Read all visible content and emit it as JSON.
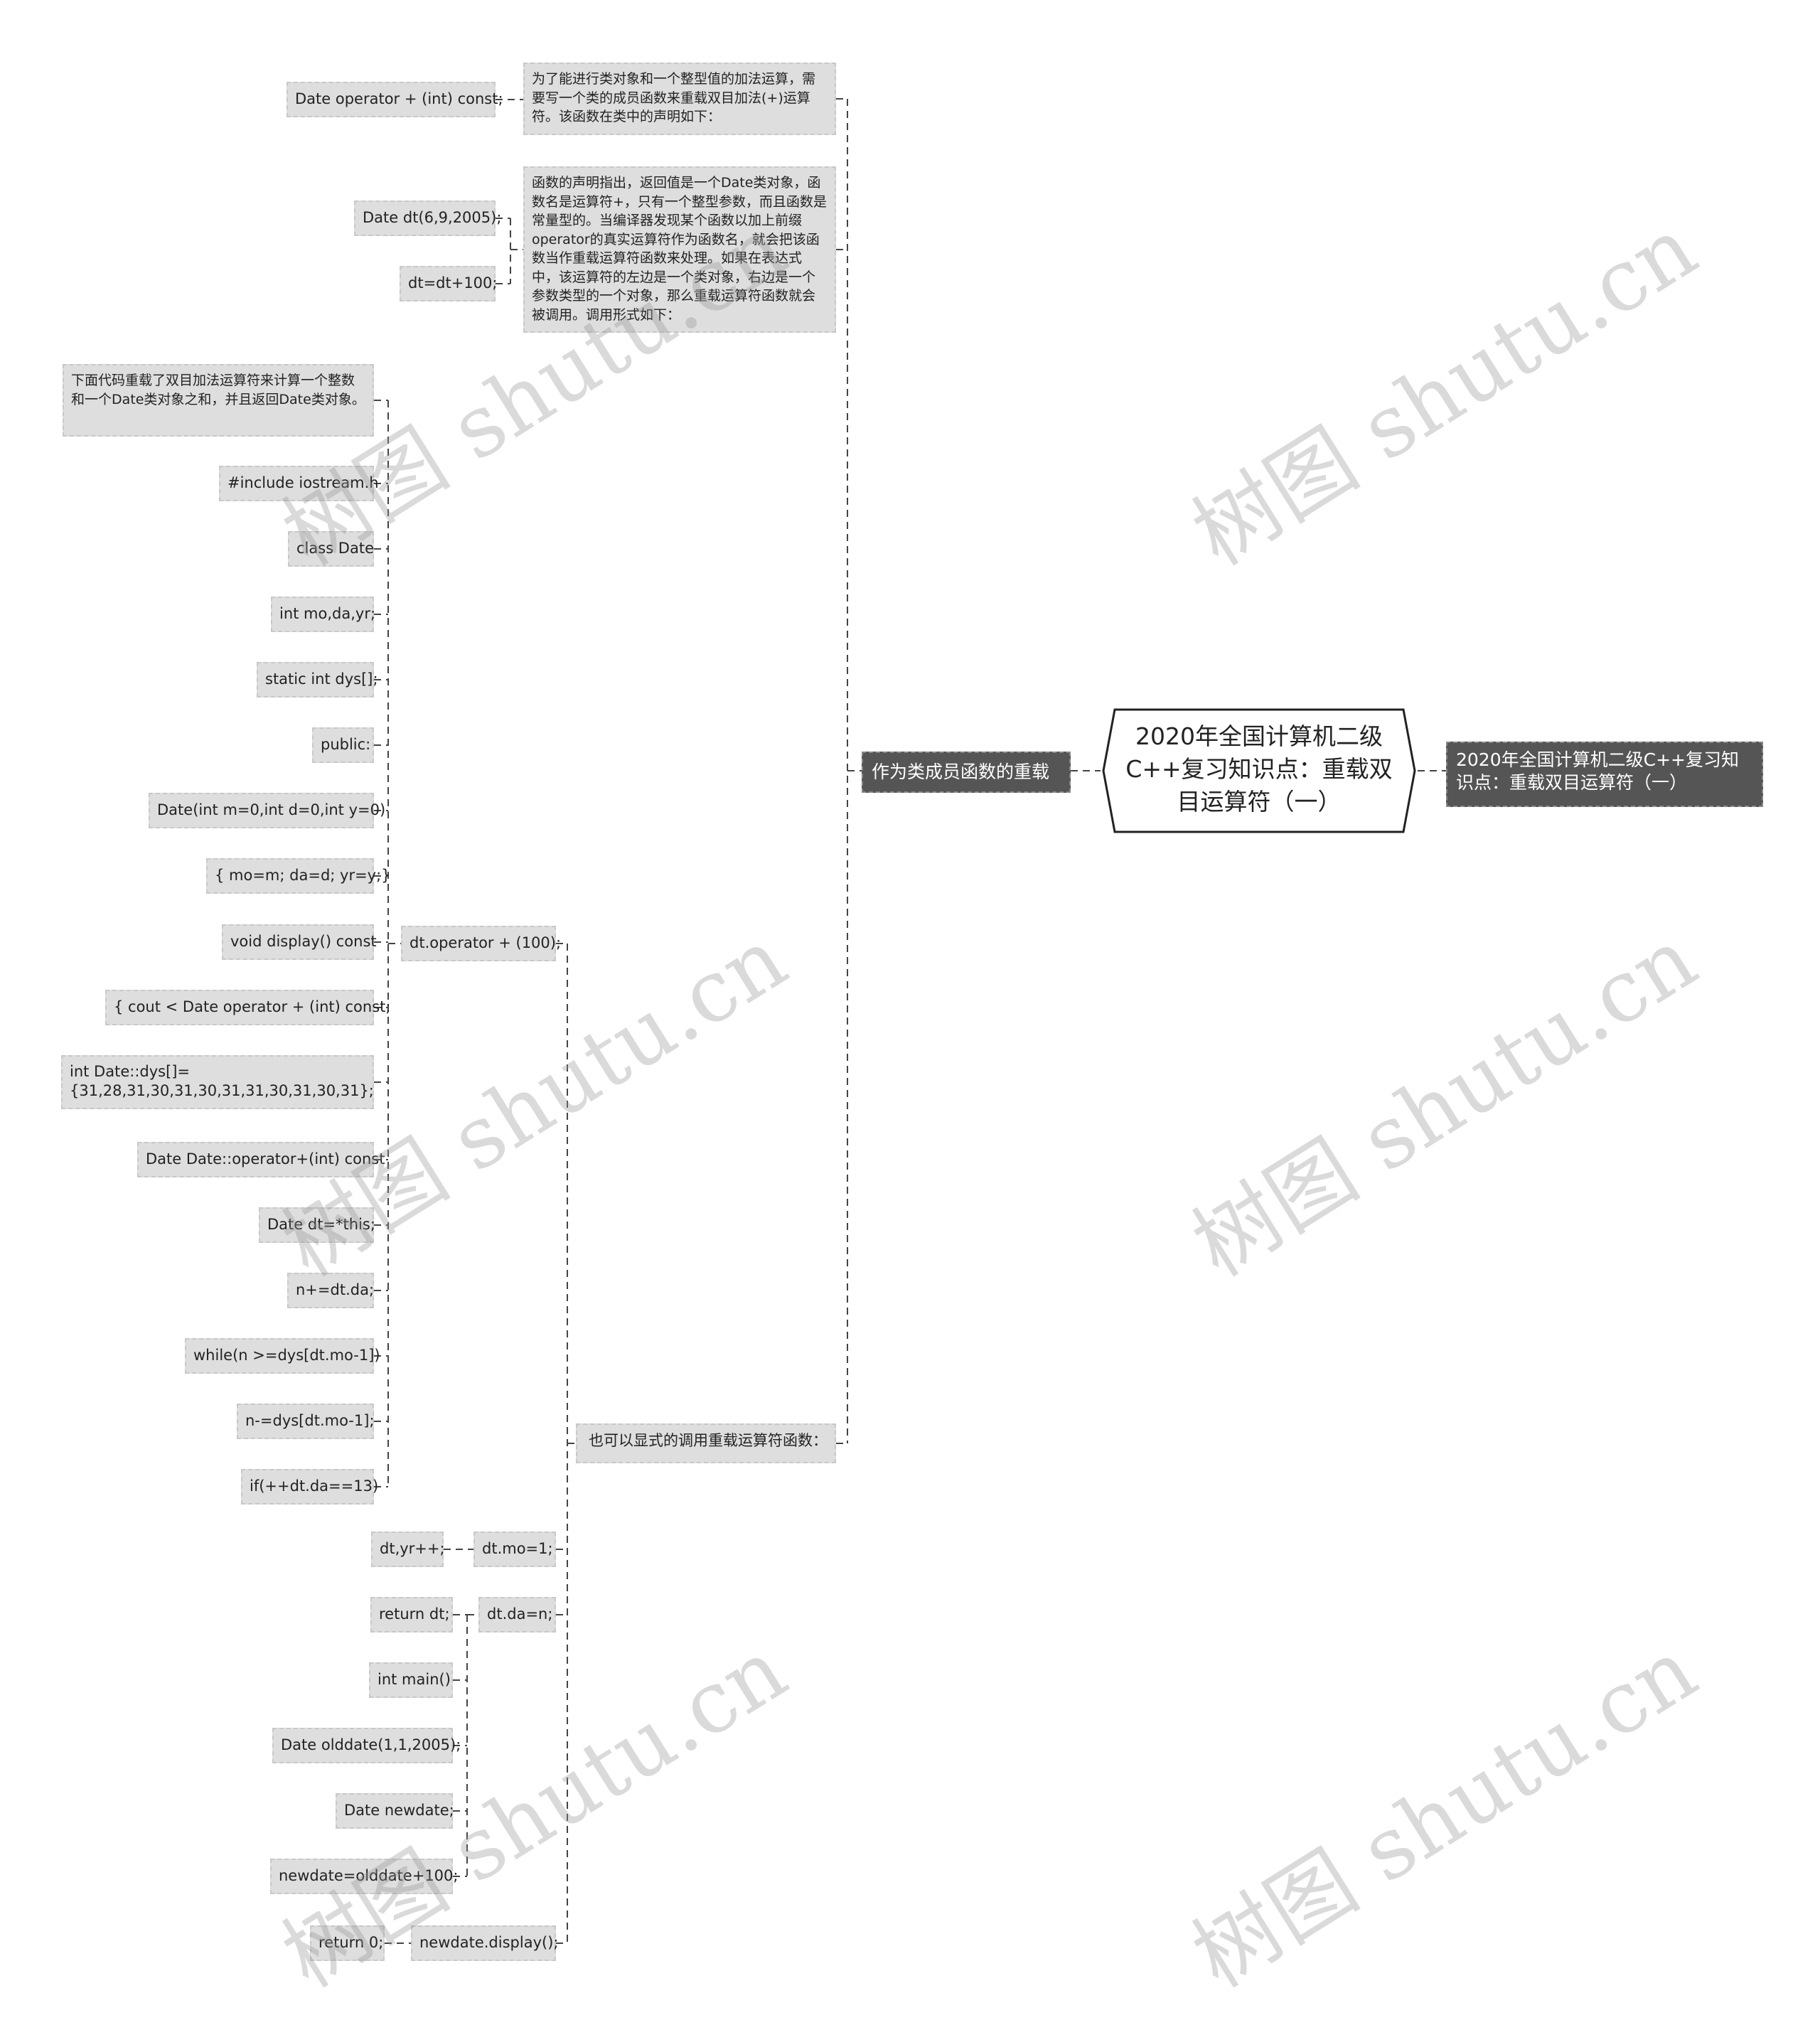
{
  "diagram": {
    "type": "mind-map",
    "root": {
      "label": "2020年全国计算机二级C++复习知识点：重载双目运算符（一）"
    },
    "right_branch": {
      "label": "2020年全国计算机二级C++复习知识点：重载双目运算符（一）"
    },
    "left_branch": {
      "label": "作为类成员函数的重载",
      "children": [
        {
          "label": "为了能进行类对象和一个整型值的加法运算，需要写一个类的成员函数来重载双目加法(+)运算符。该函数在类中的声明如下：",
          "children": [
            {
              "label": "Date operator + (int) const;"
            }
          ]
        },
        {
          "label": "函数的声明指出，返回值是一个Date类对象，函数名是运算符+，只有一个整型参数，而且函数是常量型的。当编译器发现某个函数以加上前缀operator的真实运算符作为函数名，就会把该函数当作重载运算符函数来处理。如果在表达式中，该运算符的左边是一个类对象，右边是一个参数类型的一个对象，那么重载运算符函数就会被调用。调用形式如下：",
          "children": [
            {
              "label": "Date dt(6,9,2005);"
            },
            {
              "label": "dt=dt+100;"
            }
          ]
        },
        {
          "label": "也可以显式的调用重载运算符函数：",
          "children": [
            {
              "label": "dt.operator + (100);",
              "children": [
                {
                  "label": "下面代码重载了双目加法运算符来计算一个整数和一个Date类对象之和，并且返回Date类对象。"
                },
                {
                  "label": "#include iostream.h"
                },
                {
                  "label": "class Date"
                },
                {
                  "label": "int mo,da,yr;"
                },
                {
                  "label": "static int dys[];"
                },
                {
                  "label": "public:"
                },
                {
                  "label": "Date(int m=0,int d=0,int y=0)"
                },
                {
                  "label": "{ mo=m; da=d; yr=y;}"
                },
                {
                  "label": "void display() const"
                },
                {
                  "label": "{ cout < Date operator + (int) const;"
                },
                {
                  "label": "int Date::dys[]={31,28,31,30,31,30,31,31,30,31,30,31};"
                },
                {
                  "label": "Date Date::operator+(int) const"
                },
                {
                  "label": "Date dt=*this;"
                },
                {
                  "label": "n+=dt.da;"
                },
                {
                  "label": "while(n >=dys[dt.mo-1])"
                },
                {
                  "label": "n-=dys[dt.mo-1];"
                },
                {
                  "label": "if(++dt.da==13)"
                }
              ]
            },
            {
              "label": "dt.mo=1;",
              "children": [
                {
                  "label": "dt,yr++;"
                }
              ]
            },
            {
              "label": "dt.da=n;",
              "children": [
                {
                  "label": "return dt;"
                },
                {
                  "label": "int main()"
                },
                {
                  "label": "Date olddate(1,1,2005);"
                },
                {
                  "label": "Date newdate;"
                },
                {
                  "label": "newdate=olddate+100;"
                }
              ]
            },
            {
              "label": "newdate.display();",
              "children": [
                {
                  "label": "return 0;"
                }
              ]
            }
          ]
        }
      ]
    }
  },
  "watermark": {
    "text": "树图 shutu.cn"
  },
  "colors": {
    "leaf_fill": "#dedede",
    "dark_fill": "#555555",
    "line": "#444444",
    "root_border": "#222222"
  }
}
